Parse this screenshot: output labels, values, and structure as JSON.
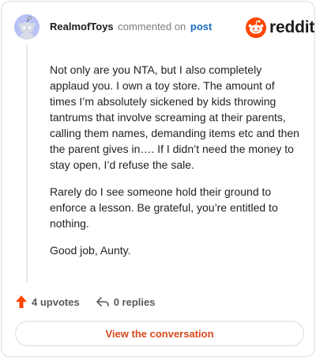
{
  "comment": {
    "username": "RealmofToys",
    "action_text": "commented on",
    "post_link": "post",
    "paragraphs": [
      "Not only are you NTA, but I also completely applaud you. I own a toy store. The amount of times I’m absolutely sickened by kids throwing tantrums that involve screaming at their parents, calling them names, demanding items etc and then the parent gives in…. If I didn’t need the money to stay open, I’d refuse the sale.",
      "Rarely do I see someone hold their ground to enforce a lesson. Be grateful, you’re entitled to nothing.",
      "Good job, Aunty."
    ],
    "upvotes": "4 upvotes",
    "replies": "0 replies"
  },
  "brand": {
    "name": "reddit",
    "color": "#ff4500"
  },
  "cta": {
    "label": "View the conversation"
  },
  "icons": {
    "avatar": "snoo-avatar-icon",
    "logo": "reddit-snoo-icon",
    "upvote": "upvote-arrow-icon",
    "reply": "reply-arrow-icon"
  }
}
